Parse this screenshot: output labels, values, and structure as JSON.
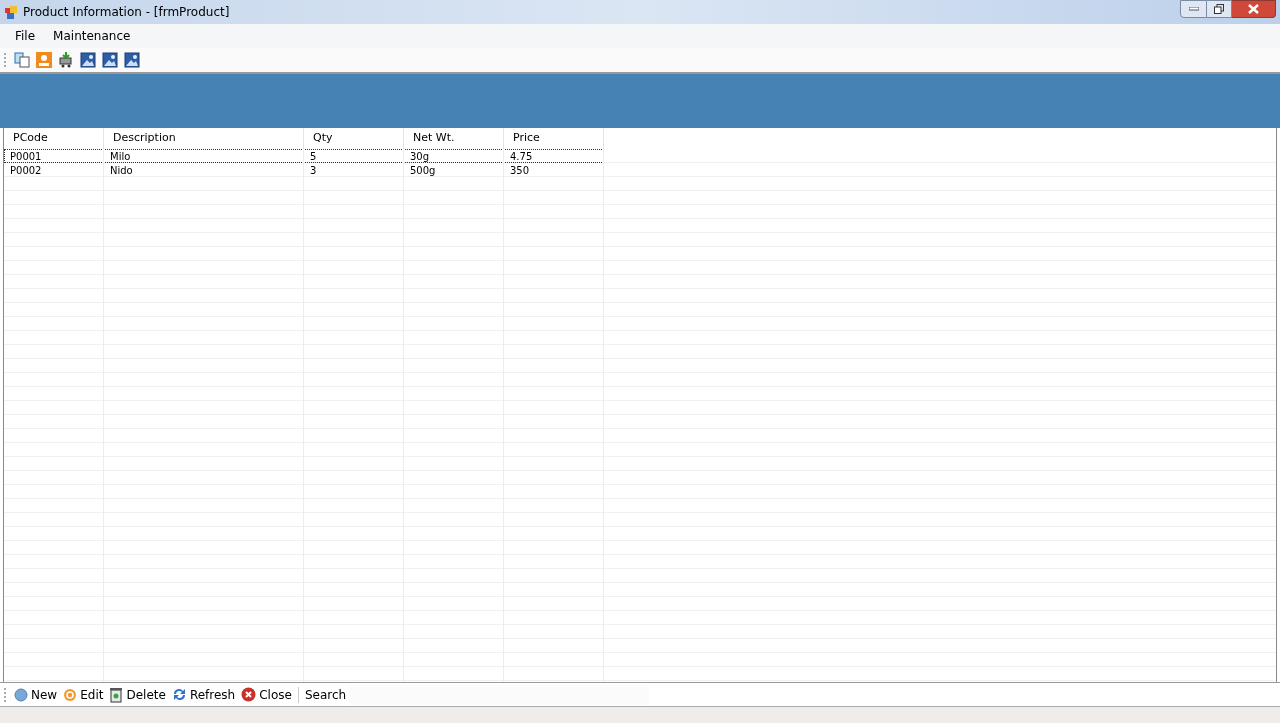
{
  "window": {
    "title": "Product Information - [frmProduct]"
  },
  "menu": [
    "File",
    "Maintenance"
  ],
  "table": {
    "columns": [
      "PCode",
      "Description",
      "Qty",
      "Net Wt.",
      "Price"
    ],
    "rows": [
      {
        "cells": [
          "P0001",
          "Milo",
          "5",
          "30g",
          "4.75"
        ],
        "focused": true
      },
      {
        "cells": [
          "P0002",
          "Nido",
          "3",
          "500g",
          "350"
        ],
        "focused": false
      }
    ]
  },
  "bottom_toolbar": {
    "buttons": [
      {
        "label": "New",
        "kind": "new"
      },
      {
        "label": "Edit",
        "kind": "edit"
      },
      {
        "label": "Delete",
        "kind": "delete"
      },
      {
        "label": "Refresh",
        "kind": "refresh"
      },
      {
        "label": "Close",
        "kind": "close"
      }
    ],
    "search_label": "Search"
  }
}
